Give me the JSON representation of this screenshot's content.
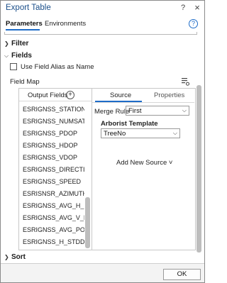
{
  "window": {
    "title": "Export Table",
    "help_glyph": "?",
    "close_glyph": "×"
  },
  "tabs": {
    "parameters": "Parameters",
    "environments": "Environments",
    "help_glyph": "?"
  },
  "sections": {
    "filter": "Filter",
    "fields": "Fields",
    "sort": "Sort"
  },
  "fields": {
    "use_alias_label": "Use Field Alias as Name",
    "use_alias_checked": false,
    "field_map_label": "Field Map",
    "output_fields_label": "Output Fields",
    "add_glyph": "+",
    "output_fields": [
      "ESRIGNSS_STATIONID",
      "ESRIGNSS_NUMSATS",
      "ESRIGNSS_PDOP",
      "ESRIGNSS_HDOP",
      "ESRIGNSS_VDOP",
      "ESRIGNSS_DIRECTION",
      "ESRIGNSS_SPEED",
      "ESRISNSR_AZIMUTH",
      "ESRIGNSS_AVG_H_R...",
      "ESRIGNSS_AVG_V_R...",
      "ESRIGNSS_AVG_POSI...",
      "ESRIGNSS_H_STDDEV"
    ]
  },
  "source_panel": {
    "source_tab": "Source",
    "properties_tab": "Properties",
    "merge_rule_label": "Merge Rule",
    "merge_rule_value": "First",
    "source_name": "Arborist Template",
    "source_field_value": "TreeNo",
    "add_new_source": "Add New Source ˅"
  },
  "footer": {
    "ok_label": "OK"
  },
  "colors": {
    "accent": "#1e6cc8",
    "title_text": "#1b4f8a"
  }
}
